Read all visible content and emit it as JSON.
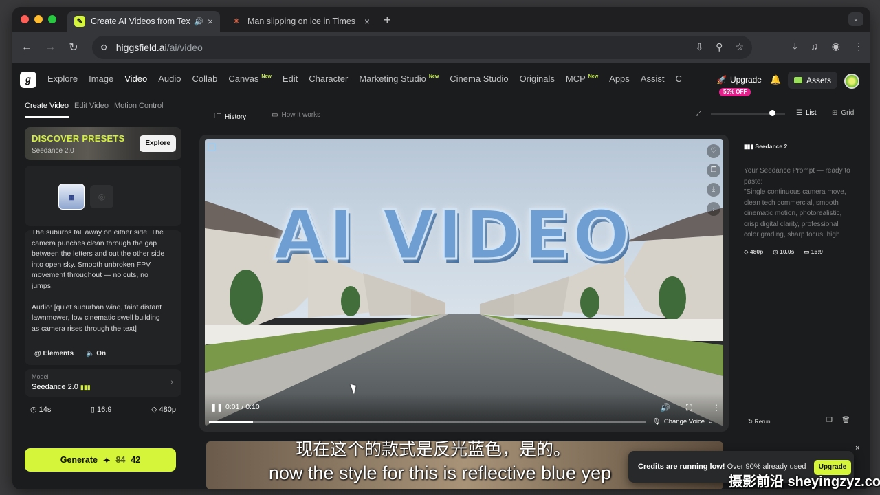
{
  "browser": {
    "tabs": [
      {
        "title": "Create AI Videos from Tex",
        "favicon": "higgsfield-logo",
        "sound_icon": "speaker-icon",
        "active": true
      },
      {
        "title": "Man slipping on ice in Times",
        "favicon": "sparkle-icon",
        "active": false
      }
    ],
    "url_host": "higgsfield.ai",
    "url_path": "/ai/video"
  },
  "app": {
    "nav": [
      {
        "label": "Explore"
      },
      {
        "label": "Image"
      },
      {
        "label": "Video",
        "active": true
      },
      {
        "label": "Audio"
      },
      {
        "label": "Collab"
      },
      {
        "label": "Canvas",
        "badge": "New"
      },
      {
        "label": "Edit"
      },
      {
        "label": "Character"
      },
      {
        "label": "Marketing Studio",
        "badge": "New"
      },
      {
        "label": "Cinema Studio"
      },
      {
        "label": "Originals"
      },
      {
        "label": "MCP",
        "badge": "New"
      },
      {
        "label": "Apps"
      },
      {
        "label": "Assist"
      },
      {
        "label": "C"
      }
    ],
    "upgrade_label": "Upgrade",
    "upgrade_badge": "55% OFF",
    "assets_label": "Assets"
  },
  "left": {
    "subtabs": [
      "Create Video",
      "Edit Video",
      "Motion Control"
    ],
    "presets_title": "DISCOVER PRESETS",
    "presets_sub": "Seedance 2.0",
    "presets_button": "Explore",
    "prompt": "The suburbs fall away on either side. The camera punches clean through the gap between the letters and out the other side into open sky. Smooth unbroken FPV movement throughout — no cuts, no jumps.\n\nAudio: [quiet suburban wind, faint distant lawnmower, low cinematic swell building as camera rises through the text]",
    "elements_label": "Elements",
    "audio_label": "On",
    "model_label": "Model",
    "model_name": "Seedance 2.0",
    "duration": "14s",
    "aspect": "16:9",
    "resolution": "480p",
    "generate_label": "Generate",
    "credits_old": "84",
    "credits_new": "42"
  },
  "center": {
    "history_label": "History",
    "how_label": "How it works",
    "list_label": "List",
    "grid_label": "Grid",
    "video_text": "AI VIDEO",
    "time": "0:01 / 0:10",
    "progress": 0.1,
    "change_voice": "Change Voice"
  },
  "right": {
    "model": "Seedance 2",
    "prompt": "Your Seedance Prompt — ready to paste:\n\"Single continuous camera move, clean tech commercial, smooth cinematic motion, photorealistic, crisp digital clarity, professional color grading, sharp focus, high",
    "resolution": "480p",
    "duration": "10.0s",
    "aspect": "16:9",
    "rerun_label": "Rerun"
  },
  "toast": {
    "bold": "Credits are running low!",
    "rest": " Over 90% already used",
    "button": "Upgrade"
  },
  "subtitles": {
    "zh": "现在这个的款式是反光蓝色，是的。",
    "en": "now the style for this is reflective blue yep"
  },
  "watermark": "摄影前沿 sheyingzyz.com",
  "colors": {
    "accent": "#d4f53a",
    "badge": "#e0228a"
  }
}
